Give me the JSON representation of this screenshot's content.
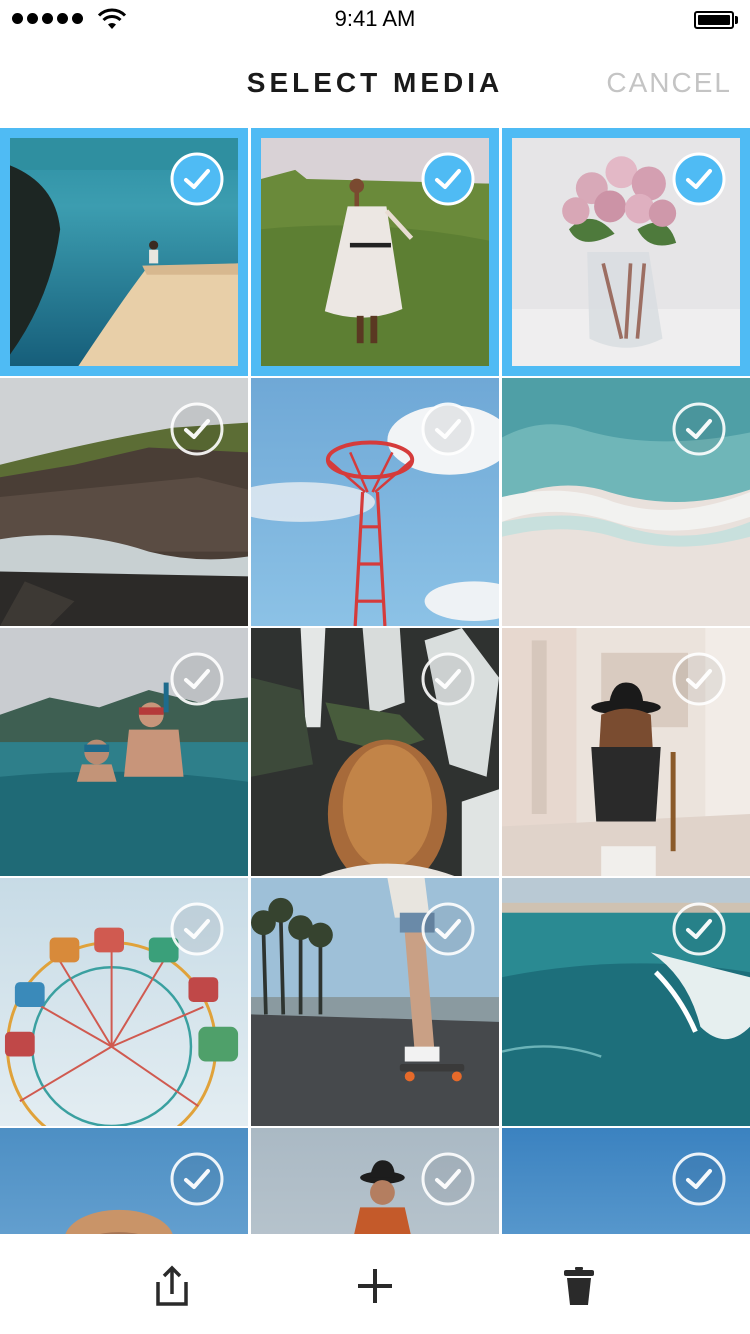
{
  "status_bar": {
    "time": "9:41 AM",
    "signal_icon": "signal-dots-icon",
    "wifi_icon": "wifi-icon",
    "battery_icon": "battery-full-icon",
    "battery_level": 1.0
  },
  "nav": {
    "title": "SELECT MEDIA",
    "cancel_label": "CANCEL"
  },
  "colors": {
    "selection_accent": "#4fbbf4",
    "title_text": "#1a1a1a",
    "cancel_text": "#c4c4c4"
  },
  "media": [
    {
      "subject": "cliff-ocean",
      "selected": true
    },
    {
      "subject": "girl-meadow",
      "selected": true
    },
    {
      "subject": "roses-vase",
      "selected": true
    },
    {
      "subject": "rocky-coast",
      "selected": false
    },
    {
      "subject": "parachute-tower",
      "selected": false
    },
    {
      "subject": "beach-waves",
      "selected": false
    },
    {
      "subject": "snorkelers",
      "selected": false
    },
    {
      "subject": "waterfall-girl",
      "selected": false
    },
    {
      "subject": "hat-girl-hallway",
      "selected": false
    },
    {
      "subject": "ferris-wheel",
      "selected": false
    },
    {
      "subject": "skateboarder",
      "selected": false
    },
    {
      "subject": "surf-aerial",
      "selected": false
    },
    {
      "subject": "hat-sky",
      "selected": false
    },
    {
      "subject": "woman-hat-sky",
      "selected": false
    },
    {
      "subject": "clear-sky",
      "selected": false
    }
  ],
  "toolbar": {
    "items": [
      {
        "icon": "share-icon"
      },
      {
        "icon": "add-icon"
      },
      {
        "icon": "trash-icon"
      }
    ]
  }
}
